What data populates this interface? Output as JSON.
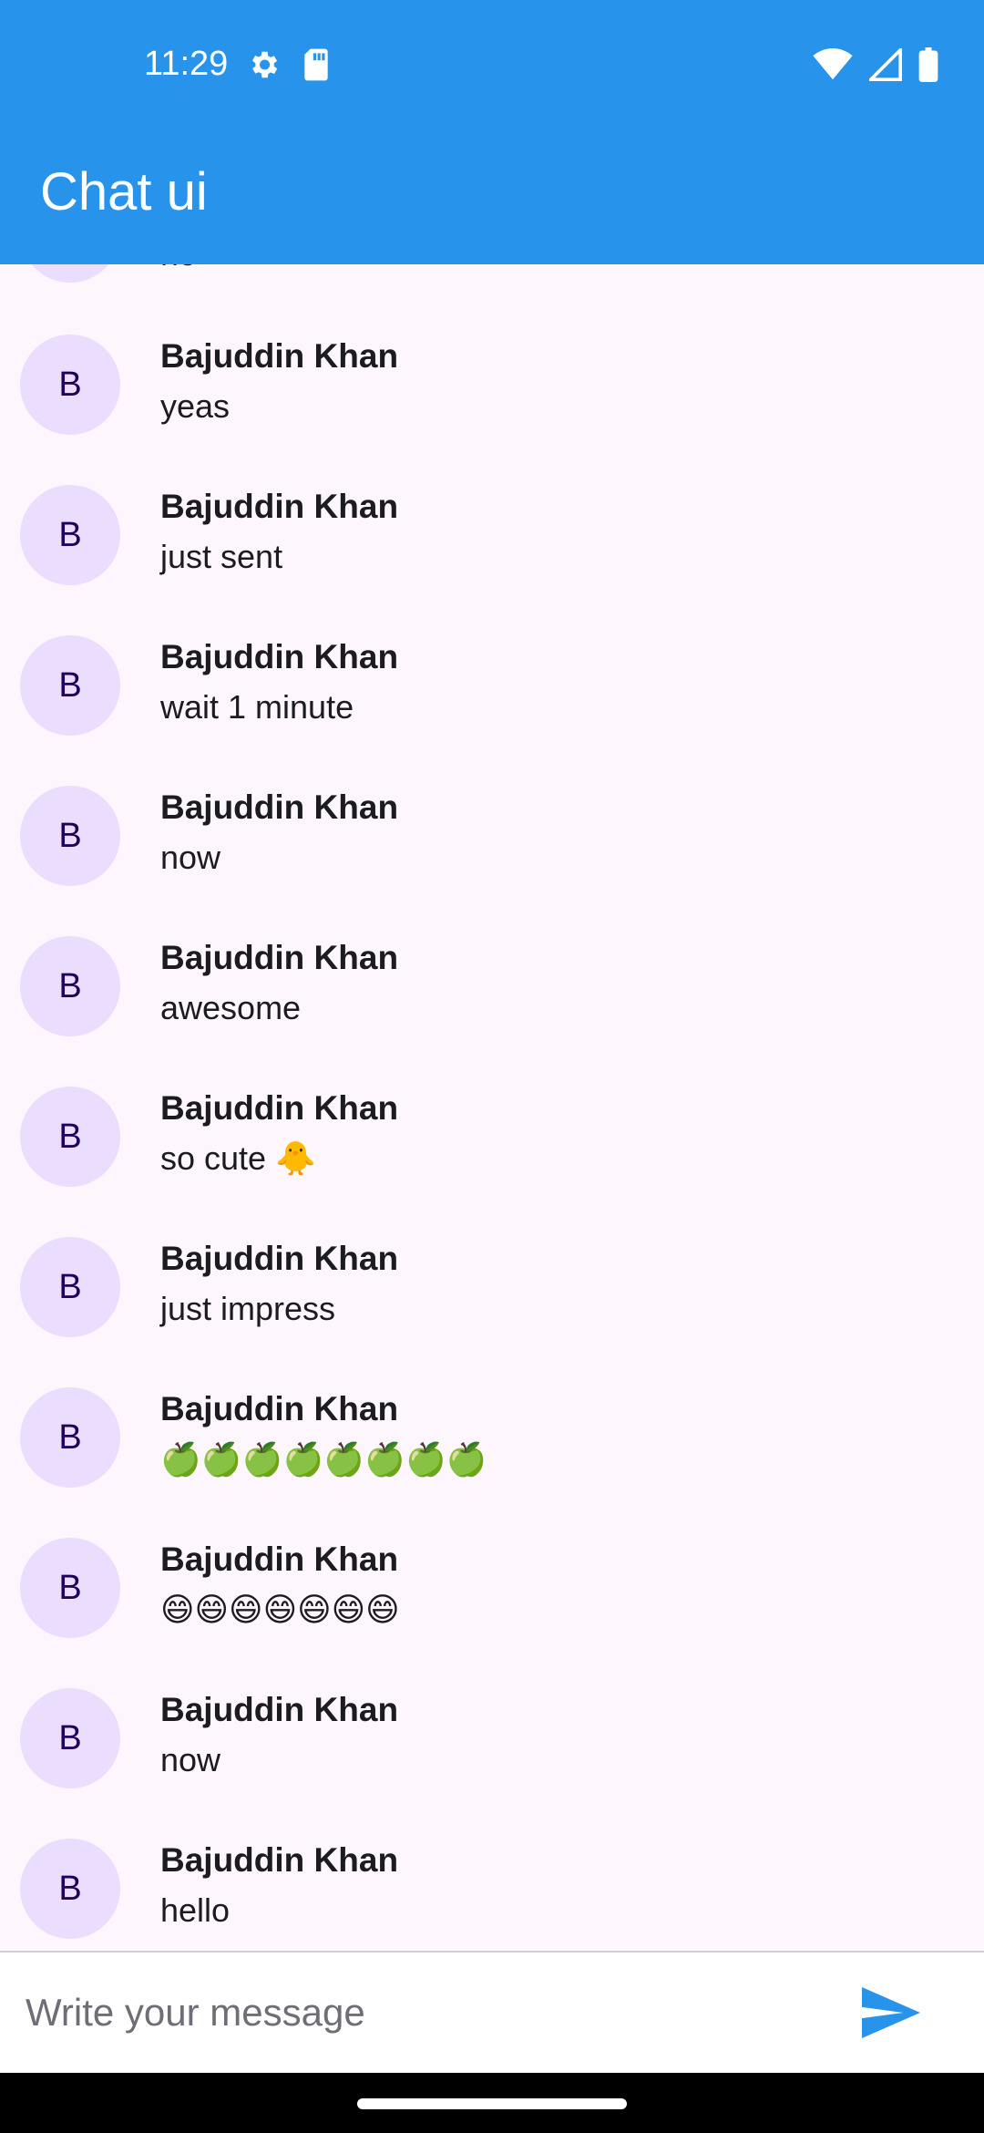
{
  "status_bar": {
    "time": "11:29",
    "left_icons": [
      "settings-icon",
      "sd-card-icon"
    ],
    "right_icons": [
      "wifi-icon",
      "signal-icon",
      "battery-icon"
    ]
  },
  "app_bar": {
    "title": "Chat ui"
  },
  "chat": {
    "partial_top": {
      "avatar": "B",
      "message": "no"
    },
    "items": [
      {
        "avatar": "B",
        "name": "Bajuddin Khan",
        "message": "yeas"
      },
      {
        "avatar": "B",
        "name": "Bajuddin Khan",
        "message": "just sent"
      },
      {
        "avatar": "B",
        "name": "Bajuddin Khan",
        "message": "wait 1 minute"
      },
      {
        "avatar": "B",
        "name": "Bajuddin Khan",
        "message": "now"
      },
      {
        "avatar": "B",
        "name": "Bajuddin Khan",
        "message": "awesome"
      },
      {
        "avatar": "B",
        "name": "Bajuddin Khan",
        "message": "so cute 🐥"
      },
      {
        "avatar": "B",
        "name": "Bajuddin Khan",
        "message": "just impress"
      },
      {
        "avatar": "B",
        "name": "Bajuddin Khan",
        "message": "🍏🍏🍏🍏🍏🍏🍏🍏"
      },
      {
        "avatar": "B",
        "name": "Bajuddin Khan",
        "message": "😄😄😄😄😄😄😄"
      },
      {
        "avatar": "B",
        "name": "Bajuddin Khan",
        "message": "now"
      },
      {
        "avatar": "B",
        "name": "Bajuddin Khan",
        "message": "hello"
      }
    ]
  },
  "composer": {
    "placeholder": "Write your message",
    "value": "",
    "send_icon": "send-icon"
  },
  "colors": {
    "primary": "#2893eb",
    "avatar_bg": "#eaddfd",
    "avatar_fg": "#21005d",
    "background": "#fdf7fd"
  }
}
